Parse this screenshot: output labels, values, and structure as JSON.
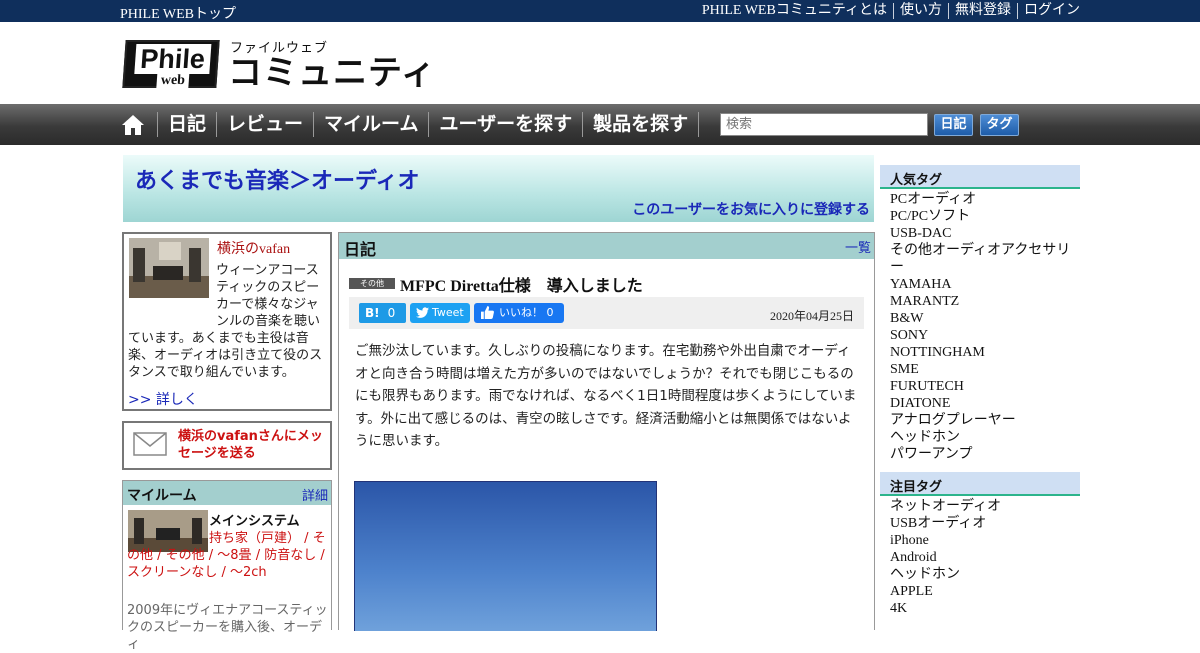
{
  "topbar": {
    "home": "PHILE WEBトップ",
    "links": [
      "PHILE WEBコミュニティとは",
      "使い方",
      "無料登録",
      "ログイン"
    ]
  },
  "logo": {
    "phile": "Phile",
    "web": "web",
    "kana": "ファイルウェブ",
    "main": "コミュニティ"
  },
  "nav": {
    "items": [
      "日記",
      "レビュー",
      "マイルーム",
      "ユーザーを探す",
      "製品を探す"
    ],
    "search_placeholder": "検索",
    "btn_diary": "日記",
    "btn_tag": "タグ"
  },
  "banner": {
    "title": "あくまでも音楽＞オーディオ",
    "favorite": "このユーザーをお気に入りに登録する"
  },
  "profile": {
    "name": "横浜のvafan",
    "bio": "ウィーンアコースティックのスピーカーで様々なジャンルの音楽を聴いています。あくまでも主役は音楽、オーディオは引き立て役のスタンスで取り組んでいます。",
    "more": ">> 詳しく"
  },
  "message": {
    "text": "横浜のvafanさんにメッセージを送る"
  },
  "myroom": {
    "title": "マイルーム",
    "detail": "詳細",
    "system": "メインシステム",
    "tags": "持ち家（戸建） / その他 / その他 / ～8畳 / 防音なし / スクリーンなし / ～2ch",
    "desc": "2009年にヴィエナアコースティックのスピーカーを購入後、オーディ"
  },
  "diary": {
    "header": "日記",
    "list_link": "一覧",
    "category": "その他",
    "title": "MFPC Diretta仕様　導入しました",
    "hatena_label": "B!",
    "hatena_count": "0",
    "tweet": "Tweet",
    "like": "いいね！ 0",
    "date": "2020年04月25日",
    "body": "ご無沙汰しています。久しぶりの投稿になります。在宅勤務や外出自粛でオーディオと向き合う時間は増えた方が多いのではないでしょうか？それでも閉じこもるのにも限界もあります。雨でなければ、なるべく1日1時間程度は歩くようにしています。外に出て感じるのは、青空の眩しさです。経済活動縮小とは無関係ではないように思います。"
  },
  "popular_tags": {
    "title": "人気タグ",
    "items": [
      "PCオーディオ",
      "PC/PCソフト",
      "USB-DAC",
      "その他オーディオアクセサリー",
      "YAMAHA",
      "MARANTZ",
      "B&W",
      "SONY",
      "NOTTINGHAM",
      "SME",
      "FURUTECH",
      "DIATONE",
      "アナログプレーヤー",
      "ヘッドホン",
      "パワーアンプ"
    ]
  },
  "featured_tags": {
    "title": "注目タグ",
    "items": [
      "ネットオーディオ",
      "USBオーディオ",
      "iPhone",
      "Android",
      "ヘッドホン",
      "APPLE",
      "4K"
    ]
  }
}
